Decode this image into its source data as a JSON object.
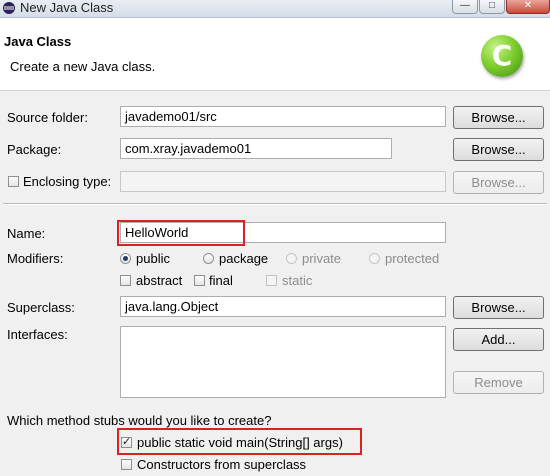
{
  "window": {
    "title": "New Java Class"
  },
  "header": {
    "title": "Java Class",
    "description": "Create a new Java class.",
    "logo_glyph": "C"
  },
  "source_folder": {
    "label": "Source folder:",
    "value": "javademo01/src",
    "button": "Browse..."
  },
  "package": {
    "label": "Package:",
    "value": "com.xray.javademo01",
    "button": "Browse..."
  },
  "enclosing": {
    "label": "Enclosing type:",
    "value": "",
    "button": "Browse...",
    "checked": false
  },
  "name": {
    "label": "Name:",
    "value": "HelloWorld"
  },
  "modifiers": {
    "label": "Modifiers:",
    "access": [
      {
        "label": "public",
        "selected": true,
        "enabled": true
      },
      {
        "label": "package",
        "selected": false,
        "enabled": true
      },
      {
        "label": "private",
        "selected": false,
        "enabled": false
      },
      {
        "label": "protected",
        "selected": false,
        "enabled": false
      }
    ],
    "flags": [
      {
        "label": "abstract",
        "checked": false,
        "enabled": true
      },
      {
        "label": "final",
        "checked": false,
        "enabled": true
      },
      {
        "label": "static",
        "checked": false,
        "enabled": false
      }
    ]
  },
  "superclass": {
    "label": "Superclass:",
    "value": "java.lang.Object",
    "button": "Browse..."
  },
  "interfaces": {
    "label": "Interfaces:",
    "add_button": "Add...",
    "remove_button": "Remove"
  },
  "stubs": {
    "question": "Which method stubs would you like to create?",
    "main": {
      "label": "public static void main(String[] args)",
      "checked": true
    },
    "constructors": {
      "label": "Constructors from superclass",
      "checked": false
    }
  },
  "colors": {
    "highlight": "#e02020",
    "logo": "#7fcf2e"
  }
}
